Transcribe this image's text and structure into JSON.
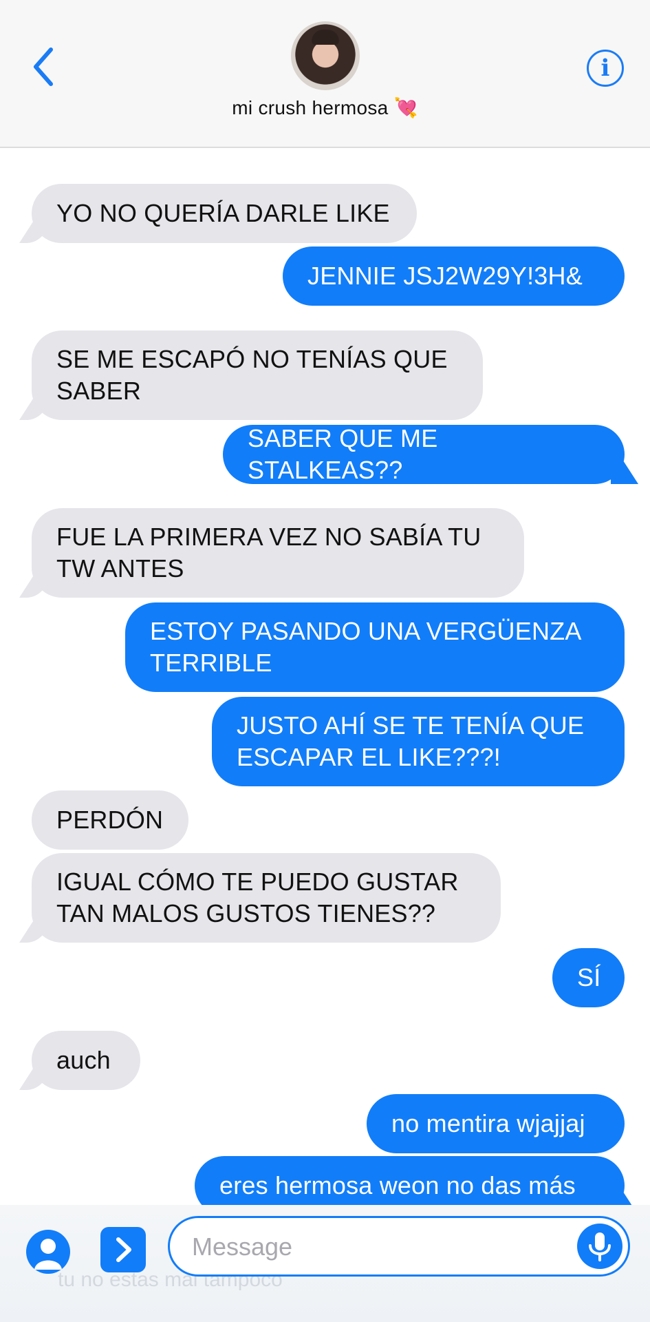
{
  "header": {
    "contact_name": "mi crush hermosa 💘",
    "info_label": "i"
  },
  "messages": [
    {
      "from": "them",
      "text": "YO NO QUERÍA DARLE LIKE"
    },
    {
      "from": "me",
      "text": "JENNIE JSJ2W29Y!3H&"
    },
    {
      "from": "them",
      "text": "SE ME ESCAPÓ NO TENÍAS QUE SABER"
    },
    {
      "from": "me",
      "text": "SABER QUE ME STALKEAS??"
    },
    {
      "from": "them",
      "text": "FUE LA PRIMERA VEZ NO SABÍA TU TW ANTES"
    },
    {
      "from": "me",
      "text": "ESTOY PASANDO UNA VERGÜENZA TERRIBLE"
    },
    {
      "from": "me",
      "text": "JUSTO AHÍ SE TE TENÍA QUE ESCAPAR EL LIKE???!"
    },
    {
      "from": "them",
      "text": "PERDÓN"
    },
    {
      "from": "them",
      "text": "IGUAL CÓMO TE PUEDO GUSTAR TAN MALOS GUSTOS TIENES??"
    },
    {
      "from": "me",
      "text": "SÍ"
    },
    {
      "from": "them",
      "text": "auch"
    },
    {
      "from": "me",
      "text": "no mentira wjajjaj"
    },
    {
      "from": "me",
      "text": "eres hermosa weon no das más"
    }
  ],
  "input_bar": {
    "placeholder": "Message",
    "ghost_text": "tu no estas mal tampoco"
  },
  "colors": {
    "accent": "#127df8",
    "incoming_bubble": "#e5e5ea",
    "header_bg": "#f7f7f7"
  },
  "icons": {
    "back": "chevron-left-icon",
    "info": "info-icon",
    "contact": "person-icon",
    "apps": "chevron-right-icon",
    "mic": "microphone-icon"
  }
}
